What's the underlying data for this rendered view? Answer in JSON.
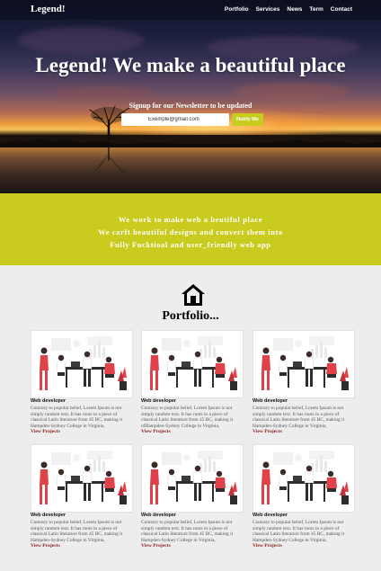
{
  "brand": "Legend!",
  "nav": [
    "Portfolio",
    "Services",
    "News",
    "Term",
    "Contact"
  ],
  "hero": {
    "title": "Legend! We make a beautiful place",
    "signup_label": "Signup for our Newsletter to be updated",
    "email_value": "Exemple@gmail.com",
    "notify_label": "Notify Me"
  },
  "band": {
    "line1": "We work to make web a beutiful place",
    "line2": "We carft beautiful designs and convert them into",
    "line3": "Fully Fucktioal and user_friendly web app"
  },
  "portfolio": {
    "title": "Portfolio...",
    "cards": [
      {
        "title": "Web developer",
        "text": "Contrary to popular belief, Lorem Ipsum is not simply random text. It has roots in a piece of classical Latin literature from 45 BC, making it Hampden-Sydney College in Virginia,",
        "link": "View Projects"
      },
      {
        "title": "Web developer",
        "text": "Contrary to popular belief, Lorem Ipsum is not simply random text. It has roots in a piece of classical Latin literature from 45 BC, making it ofHampden-Sydney College in Virginia,",
        "link": "View Projects"
      },
      {
        "title": "Web developer",
        "text": "Contrary to popular belief, Lorem Ipsum is not simply random text. It has roots in a piece of classical Latin literature from 45 BC, making it Hampden-Sydney College in Virginia,",
        "link": "View Projects"
      },
      {
        "title": "Web developer",
        "text": "Contrary to popular belief, Lorem Ipsum is not simply random text. It has roots in a piece of classical Latin literature from 45 BC, making it Hampden-Sydney College in Virginia,",
        "link": "View Projects"
      },
      {
        "title": "Web developer",
        "text": "Contrary to popular belief, Lorem Ipsum is not simply random text. It has roots in a piece of classical Latin literature from 45 BC, making it Hampden-Sydney College in Virginia,",
        "link": "View Projects"
      },
      {
        "title": "Web developer",
        "text": "Contrary to popular belief, Lorem Ipsum is not simply random text. It has roots in a piece of classical Latin literature from 45 BC, making it Hampden-Sydney College in Virginia,",
        "link": "View Projects"
      }
    ]
  },
  "colors": {
    "accent": "#c9cc1f",
    "link": "#8b1a1a",
    "background": "#ededed"
  },
  "icons": {
    "portfolio": "home-icon"
  }
}
